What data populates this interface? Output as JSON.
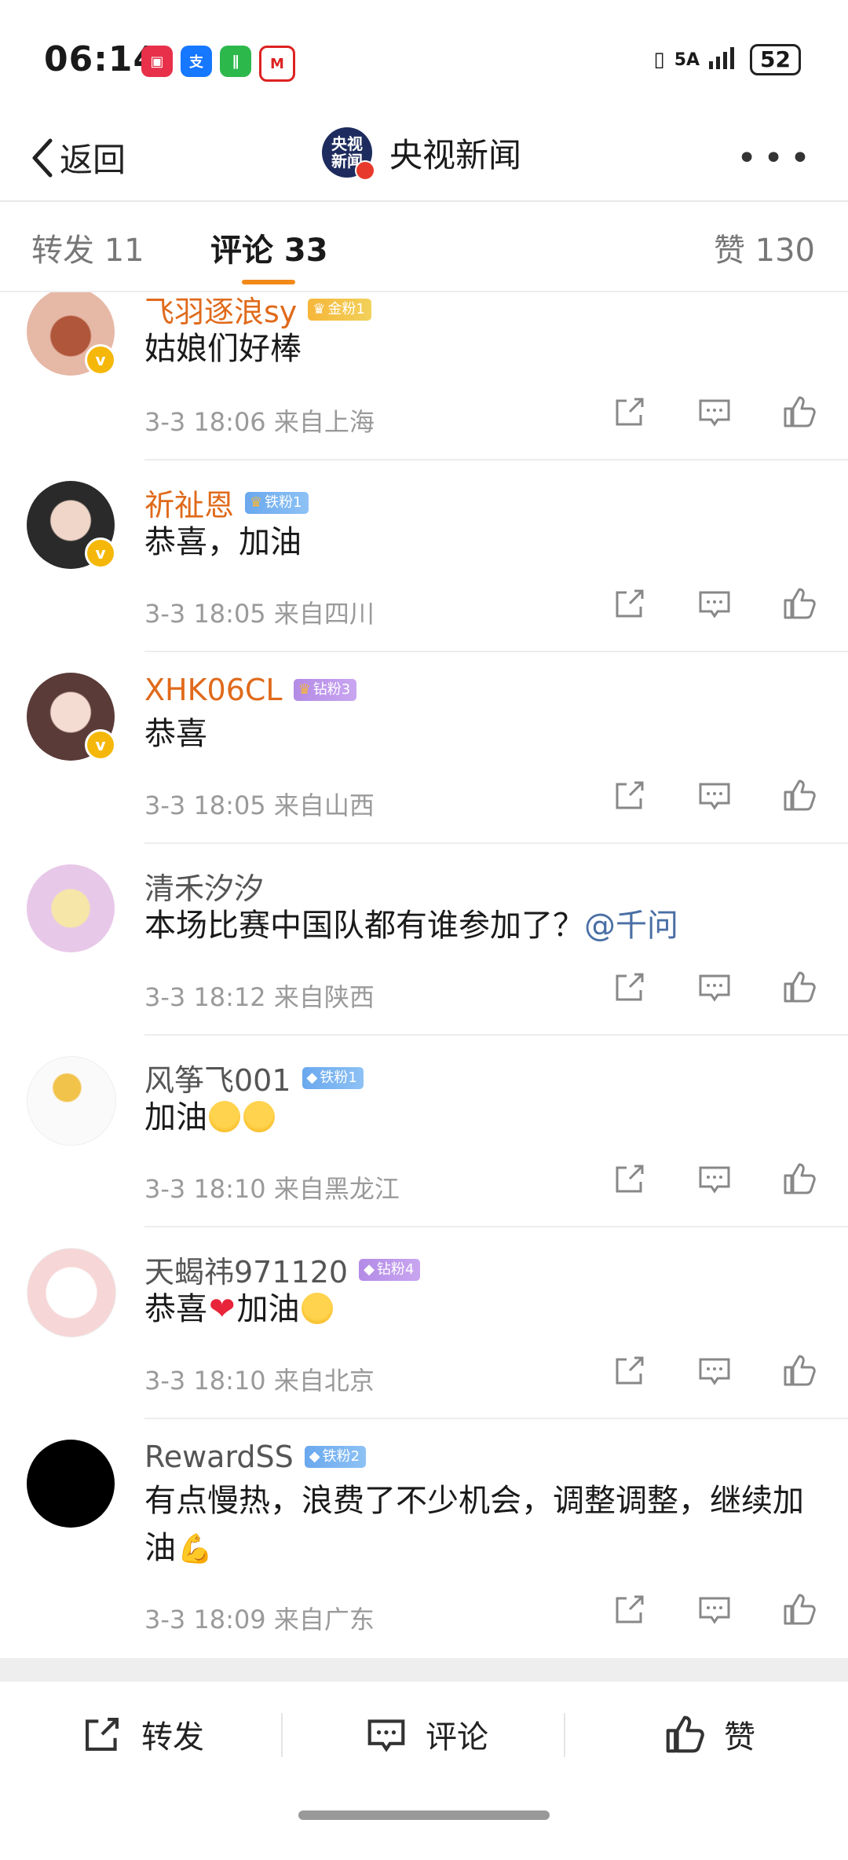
{
  "status": {
    "time": "06:14",
    "network": "5A",
    "battery": "52"
  },
  "nav": {
    "back_label": "返回",
    "title": "央视新闻",
    "logo_text": "央视新闻"
  },
  "tabs": [
    {
      "label": "转发 11"
    },
    {
      "label": "评论 33"
    },
    {
      "label": "赞 130"
    }
  ],
  "comments": [
    {
      "name": "飞羽逐浪sy",
      "badge": "金粉1",
      "text": "姑娘们好棒",
      "meta": "3-3 18:06 来自上海"
    },
    {
      "name": "祈祉恩",
      "badge": "铁粉1",
      "text": "恭喜，加油",
      "meta": "3-3 18:05 来自四川"
    },
    {
      "name": "XHK06CL",
      "badge": "钻粉3",
      "text": "恭喜",
      "meta": "3-3 18:05 来自山西"
    },
    {
      "name": "清禾汐汐",
      "badge": "",
      "text": "本场比赛中国队都有谁参加了？",
      "mention": "@千问",
      "meta": "3-3 18:12 来自陕西"
    },
    {
      "name": "风筝飞001",
      "badge": "铁粉1",
      "text": "加油",
      "meta": "3-3 18:10 来自黑龙江"
    },
    {
      "name": "天蝎祎971120",
      "badge": "钻粉4",
      "text_a": "恭喜",
      "text_b": "加油",
      "meta": "3-3 18:10 来自北京"
    },
    {
      "name": "RewardSS",
      "badge": "铁粉2",
      "text": "有点慢热，浪费了不少机会，调整调整，继续加油",
      "meta": "3-3 18:09 来自广东"
    }
  ],
  "bottom": {
    "repost_label": "转发",
    "comment_label": "评论",
    "like_label": "赞"
  },
  "colors": {
    "accent": "#f28a1a",
    "username_orange": "#e06a1b",
    "mention": "#4a6fa5",
    "meta_gray": "#9a9a9a"
  }
}
